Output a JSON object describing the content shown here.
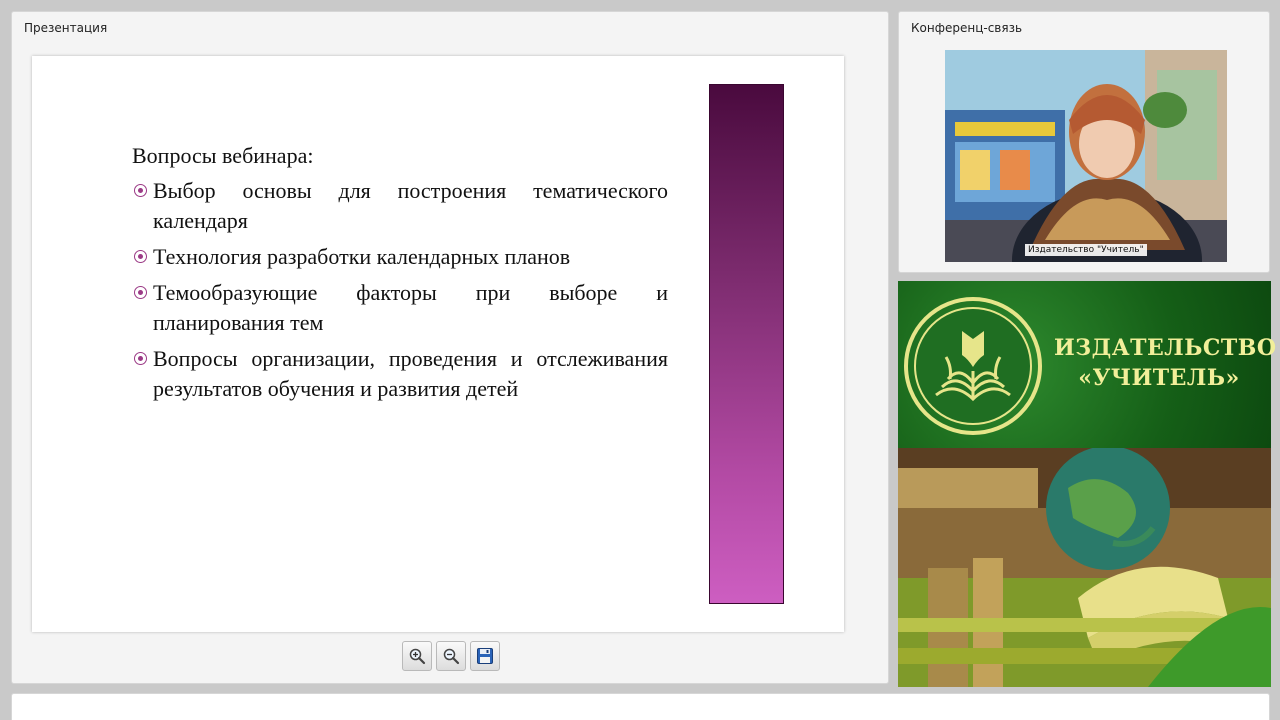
{
  "presentation": {
    "title": "Презентация",
    "slide": {
      "heading": "Вопросы вебинара:",
      "items": [
        "Выбор основы для построения тематического календаря",
        "Технология разработки календарных планов",
        "Темообразующие   факторы при выборе и планирования тем",
        "Вопросы организации, проведения и отслеживания результатов обучения и развития детей"
      ],
      "accent_color": "#9b3a86"
    },
    "toolbar": {
      "zoom_in_icon": "zoom-in-icon",
      "zoom_out_icon": "zoom-out-icon",
      "save_icon": "floppy-disk-icon"
    }
  },
  "conference": {
    "title": "Конференц-связь",
    "participant_name": "Издательство \"Учитель\""
  },
  "banner": {
    "publisher_line1": "ИЗДАТЕЛЬСТВО",
    "publisher_line2": "«УЧИТЕЛЬ»",
    "logo_icon": "book-emblem-icon",
    "text_color": "#f2ef9a",
    "bg_color": "#155f17"
  }
}
